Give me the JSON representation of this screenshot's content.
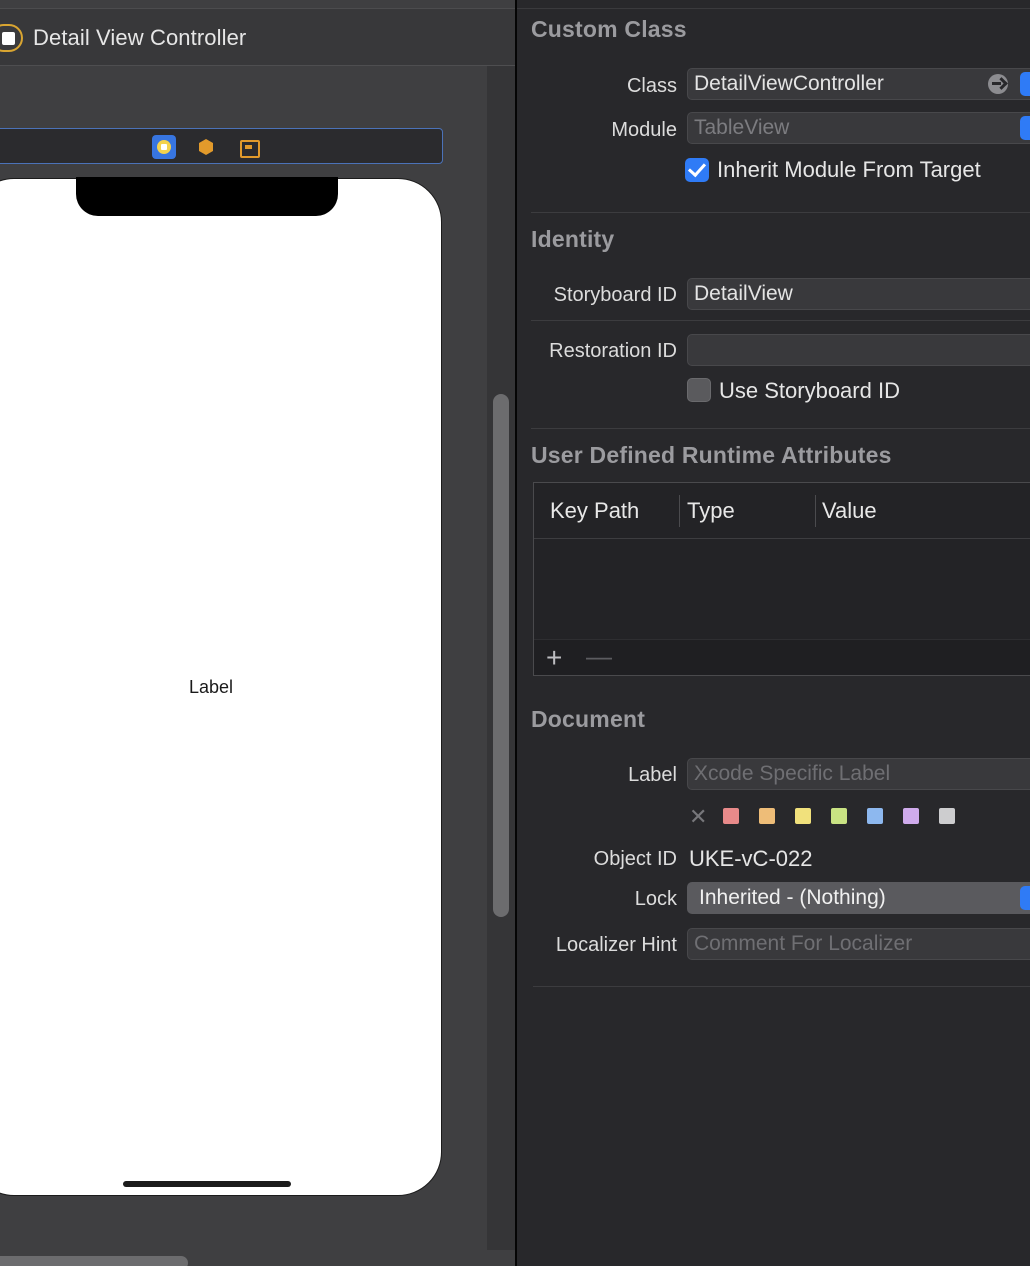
{
  "canvas": {
    "scene_title": "Detail View Controller",
    "device_label": "Label"
  },
  "inspector": {
    "custom_class": {
      "title": "Custom Class",
      "class_label": "Class",
      "class_value": "DetailViewController",
      "module_label": "Module",
      "module_placeholder": "TableView",
      "inherit_label": "Inherit Module From Target",
      "inherit_checked": true
    },
    "identity": {
      "title": "Identity",
      "storyboard_id_label": "Storyboard ID",
      "storyboard_id_value": "DetailView",
      "restoration_id_label": "Restoration ID",
      "restoration_id_value": "",
      "use_storyboard_id_label": "Use Storyboard ID",
      "use_storyboard_id_checked": false
    },
    "runtime_attributes": {
      "title": "User Defined Runtime Attributes",
      "columns": [
        "Key Path",
        "Type",
        "Value"
      ],
      "rows": [],
      "add_symbol": "+",
      "remove_symbol": "—"
    },
    "document": {
      "title": "Document",
      "label_label": "Label",
      "label_placeholder": "Xcode Specific Label",
      "clear_symbol": "✕",
      "swatches": [
        "#e88a8a",
        "#eebd78",
        "#f1e17c",
        "#c9e383",
        "#8db8ef",
        "#cfabec",
        "#cdcdcf"
      ],
      "object_id_label": "Object ID",
      "object_id_value": "UKE-vC-022",
      "lock_label": "Lock",
      "lock_value": "Inherited - (Nothing)",
      "localizer_hint_label": "Localizer Hint",
      "localizer_hint_placeholder": "Comment For Localizer"
    }
  },
  "colors": {
    "accent": "#2f7bf6",
    "canvas_bg": "#3f3f41",
    "inspector_bg": "#28282b",
    "scene_icon": "#d9a531"
  },
  "icons": {
    "scene": "view-controller-icon",
    "vc_bar": [
      "view-controller-icon",
      "first-responder-icon",
      "exit-icon"
    ],
    "class_field": "arrow-circle-right-icon"
  }
}
